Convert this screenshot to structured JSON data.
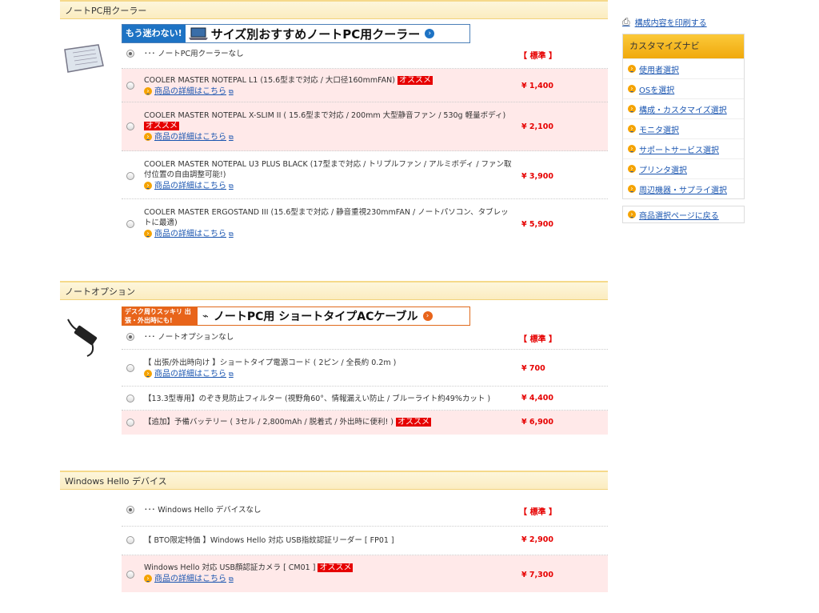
{
  "sections": [
    {
      "title": "ノートPC用クーラー",
      "banner": {
        "lead": "もう迷わない!",
        "main": "サイズ別おすすめノートPC用クーラー"
      },
      "items": [
        {
          "text": "･･･ ノートPC用クーラーなし",
          "price": "【 標準 】",
          "selected": true,
          "standard": true
        },
        {
          "text": "COOLER MASTER NOTEPAL L1 (15.6型まで対応 / 大口径160mmFAN)",
          "badge": "オススメ",
          "detail": "商品の詳細はこちら",
          "price": "¥ 1,400"
        },
        {
          "text": "COOLER MASTER NOTEPAL X-SLIM II ( 15.6型まで対応 / 200mm 大型静音ファン / 530g 軽量ボディ)",
          "badge": "オススメ",
          "detail": "商品の詳細はこちら",
          "price": "¥ 2,100"
        },
        {
          "text": "COOLER MASTER NOTEPAL U3 PLUS BLACK (17型まで対応 / トリプルファン / アルミボディ / ファン取付位置の自由調整可能!)",
          "detail": "商品の詳細はこちら",
          "price": "¥ 3,900"
        },
        {
          "text": "COOLER MASTER ERGOSTAND III (15.6型まで対応 / 静音重視230mmFAN / ノートパソコン、タブレットに最適)",
          "detail": "商品の詳細はこちら",
          "price": "¥ 5,900"
        }
      ]
    },
    {
      "title": "ノートオプション",
      "banner": {
        "lead": "デスク周りスッキリ 出張・外出時にも!",
        "main": "ノートPC用 ショートタイプACケーブル"
      },
      "items": [
        {
          "text": "･･･ ノートオプションなし",
          "price": "【 標準 】",
          "selected": true,
          "standard": true
        },
        {
          "text": "【 出張/外出時向け 】ショートタイプ電源コード ( 2ピン / 全長約 0.2m )",
          "detail": "商品の詳細はこちら",
          "price": "¥ 700"
        },
        {
          "text": "【13.3型専用】のぞき見防止フィルター (視野角60°、情報漏えい防止 / ブルーライト約49%カット )",
          "price": "¥ 4,400"
        },
        {
          "text": "【追加】予備バッテリー ( 3セル / 2,800mAh / 脱着式 / 外出時に便利! )",
          "badge": "オススメ",
          "price": "¥ 6,900"
        }
      ]
    },
    {
      "title": "Windows Hello デバイス",
      "items": [
        {
          "text": "･･･ Windows Hello デバイスなし",
          "price": "【 標準 】",
          "selected": true,
          "standard": true
        },
        {
          "text": "【 BTO限定特価 】Windows Hello 対応 USB指紋認証リーダー [ FP01 ]",
          "price": "¥ 2,900"
        },
        {
          "text": "Windows Hello 対応 USB顔認証カメラ [ CM01 ]",
          "badge": "オススメ",
          "detail": "商品の詳細はこちら",
          "price": "¥ 7,300"
        }
      ]
    }
  ],
  "sidebar": {
    "print_label": "構成内容を印刷する",
    "nav_title": "カスタマイズナビ",
    "nav_items": [
      "使用者選択",
      "OSを選択",
      "構成・カスタマイズ選択",
      "モニタ選択",
      "サポートサービス選択",
      "プリンタ選択",
      "周辺機器・サプライ選択"
    ],
    "back_label": "商品選択ページに戻る"
  },
  "colors": {
    "accent": "#e60000",
    "link": "#1a55b0",
    "nav": "#f0a90c",
    "row_pink": "#ffe9e9"
  }
}
